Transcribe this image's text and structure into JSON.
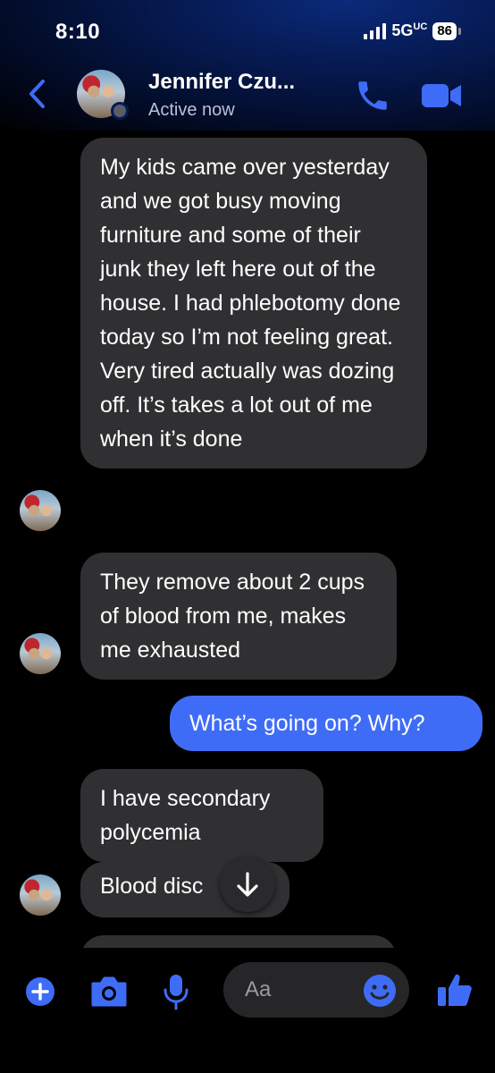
{
  "status_bar": {
    "time": "8:10",
    "network": "5G",
    "network_suffix": "UC",
    "battery": "86"
  },
  "header": {
    "contact_name": "Jennifer Czu...",
    "active_status": "Active now",
    "icons": [
      "back-chevron-icon",
      "phone-icon",
      "video-camera-icon"
    ]
  },
  "messages": [
    {
      "from": "them",
      "text": "My kids came over yesterday and we got busy moving furniture and some of their junk they left here out of the house. I had phlebotomy done today so I’m not feeling great. Very tired actually was dozing off. It’s takes a lot out of me when it’s done"
    },
    {
      "from": "them",
      "text": "They remove about 2 cups of blood from me, makes me exhausted"
    },
    {
      "from": "me",
      "text": "What’s going on? Why?"
    },
    {
      "from": "them",
      "text": "I have secondary polycemia"
    },
    {
      "from": "them",
      "text": "Blood disc"
    }
  ],
  "composer": {
    "placeholder": "Aa",
    "icons": [
      "plus-icon",
      "camera-icon",
      "microphone-icon",
      "emoji-icon",
      "thumbs-up-icon"
    ]
  },
  "colors": {
    "accent": "#3f6cf7",
    "incoming_bubble": "#303032",
    "background": "#000000"
  }
}
